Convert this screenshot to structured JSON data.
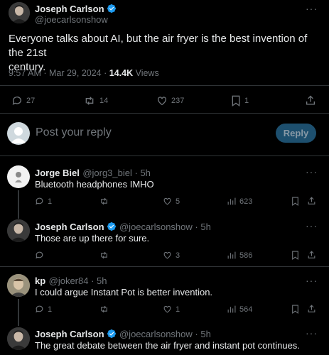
{
  "main_tweet": {
    "author_name": "Joseph Carlson",
    "author_handle": "@joecarlsonshow",
    "text_line1": "Everyone talks about AI, but the air fryer is the best invention of the 21st",
    "text_line2": "century.",
    "time": "9:57 AM · Mar 29, 2024 · ",
    "views_count": "14.4K",
    "views_label": " Views",
    "stats": {
      "replies": "27",
      "retweets": "14",
      "likes": "237",
      "bookmarks": "1"
    },
    "more": "···"
  },
  "composer": {
    "placeholder": "Post your reply",
    "reply_button": "Reply"
  },
  "replies": [
    {
      "author_name": "Jorge Biel",
      "author_handle": "@jorg3_biel",
      "time": " · 5h",
      "text": "Bluetooth headphones IMHO",
      "stats": {
        "replies": "1",
        "retweets": "",
        "likes": "5",
        "views": "623"
      },
      "more": "···"
    },
    {
      "author_name": "Joseph Carlson",
      "author_handle": "@joecarlsonshow",
      "time": " · 5h",
      "text": "Those are up there for sure.",
      "stats": {
        "replies": "",
        "retweets": "",
        "likes": "3",
        "views": "586"
      },
      "more": "···"
    },
    {
      "author_name": "kp",
      "author_handle": "@joker84",
      "time": " · 5h",
      "text": "I could argue Instant Pot is better invention.",
      "stats": {
        "replies": "1",
        "retweets": "",
        "likes": "1",
        "views": "564"
      },
      "more": "···"
    },
    {
      "author_name": "Joseph Carlson",
      "author_handle": "@joecarlsonshow",
      "time": " · 5h",
      "text": "The great debate between the air fryer and instant pot continues.",
      "more": "···"
    }
  ],
  "colors": {
    "background": "#000000",
    "text": "#e7e9ea",
    "muted": "#71767b",
    "verified": "#1d9bf0",
    "reply_button_bg": "#1d4f6e"
  }
}
